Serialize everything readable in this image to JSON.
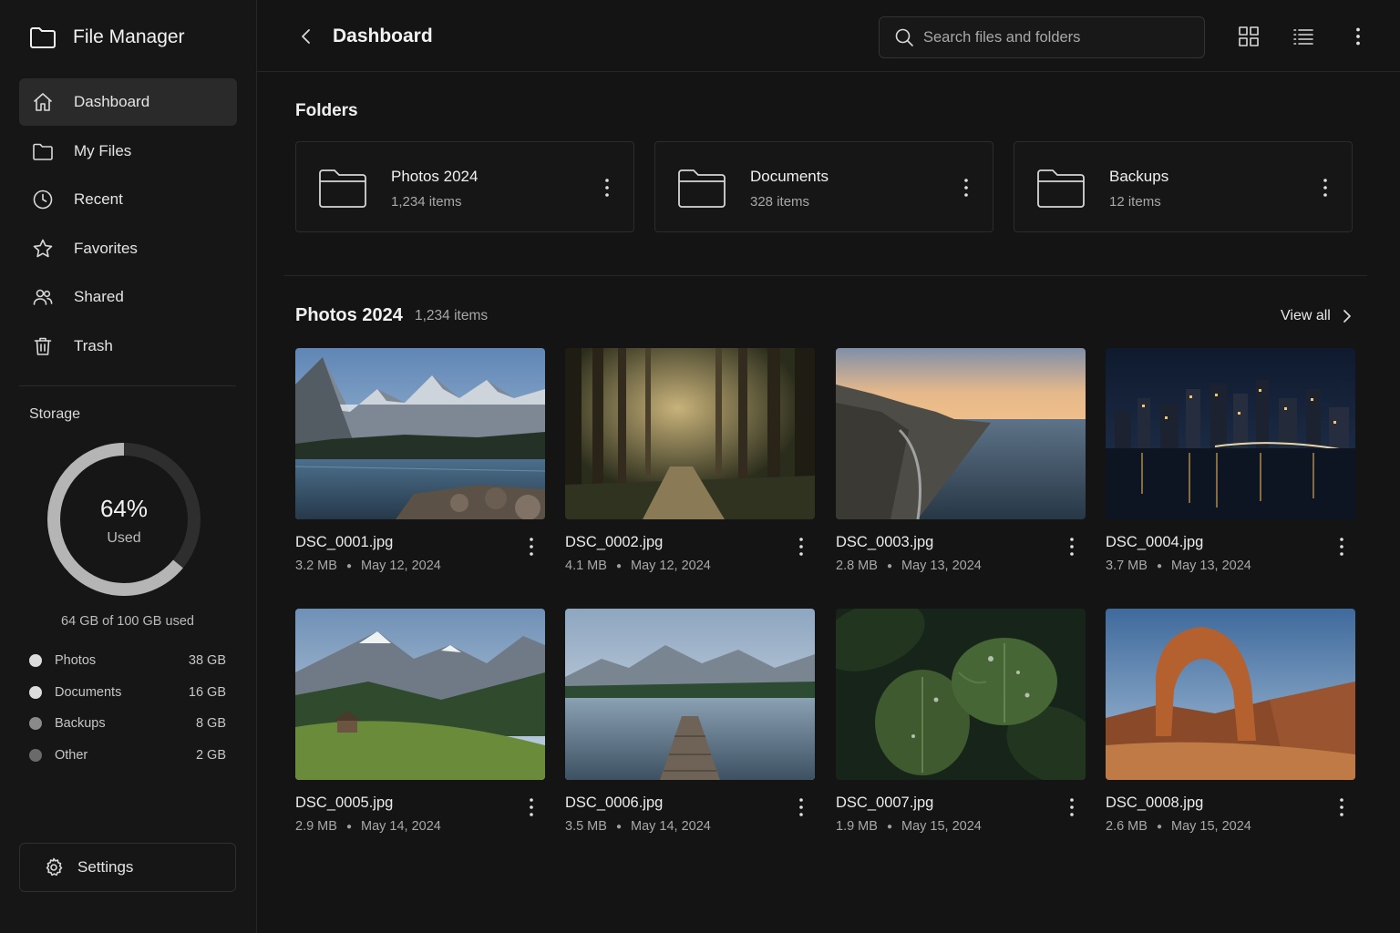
{
  "app": {
    "title": "File Manager",
    "icon": "folder-icon"
  },
  "nav": {
    "items": [
      {
        "label": "Dashboard",
        "icon": "home-icon",
        "active": true
      },
      {
        "label": "My Files",
        "icon": "folder-icon",
        "active": false
      },
      {
        "label": "Recent",
        "icon": "clock-icon",
        "active": false
      },
      {
        "label": "Favorites",
        "icon": "star-icon",
        "active": false
      },
      {
        "label": "Shared",
        "icon": "users-icon",
        "active": false
      },
      {
        "label": "Trash",
        "icon": "trash-icon",
        "active": false
      }
    ]
  },
  "storage": {
    "title": "Storage",
    "percent_label": "64%",
    "used_fraction": 0.64,
    "used_label": "Used",
    "summary": "64 GB of 100 GB used",
    "colors": {
      "used": "#b5b5b5",
      "track": "#2e2e2e"
    },
    "breakdown": [
      {
        "name": "Photos",
        "size": "38 GB",
        "color": "#dcdcdc"
      },
      {
        "name": "Documents",
        "size": "16 GB",
        "color": "#dcdcdc"
      },
      {
        "name": "Backups",
        "size": "8 GB",
        "color": "#8a8a8a"
      },
      {
        "name": "Other",
        "size": "2 GB",
        "color": "#6a6a6a"
      }
    ]
  },
  "settings": {
    "label": "Settings",
    "icon": "gear-icon"
  },
  "header": {
    "back_icon": "chevron-left-icon",
    "title": "Dashboard",
    "search_placeholder": "Search files and folders",
    "grid_view_icon": "grid-view-icon",
    "list_view_icon": "list-view-icon",
    "more_icon": "more-vertical-icon"
  },
  "folders": {
    "title": "Folders",
    "items": [
      {
        "name": "Photos 2024",
        "count": "1,234 items"
      },
      {
        "name": "Documents",
        "count": "328 items"
      },
      {
        "name": "Backups",
        "count": "12 items"
      }
    ]
  },
  "photos": {
    "title": "Photos 2024",
    "count": "1,234 items",
    "view_all": "View all",
    "items": [
      {
        "name": "DSC_0001.jpg",
        "size": "3.2 MB",
        "date": "May 12, 2024",
        "scene": "mountain-lake"
      },
      {
        "name": "DSC_0002.jpg",
        "size": "4.1 MB",
        "date": "May 12, 2024",
        "scene": "forest-path"
      },
      {
        "name": "DSC_0003.jpg",
        "size": "2.8 MB",
        "date": "May 13, 2024",
        "scene": "sea-cliffs"
      },
      {
        "name": "DSC_0004.jpg",
        "size": "3.7 MB",
        "date": "May 13, 2024",
        "scene": "city-night"
      },
      {
        "name": "DSC_0005.jpg",
        "size": "2.9 MB",
        "date": "May 14, 2024",
        "scene": "alpine-valley"
      },
      {
        "name": "DSC_0006.jpg",
        "size": "3.5 MB",
        "date": "May 14, 2024",
        "scene": "lake-pier"
      },
      {
        "name": "DSC_0007.jpg",
        "size": "1.9 MB",
        "date": "May 15, 2024",
        "scene": "green-leaves"
      },
      {
        "name": "DSC_0008.jpg",
        "size": "2.6 MB",
        "date": "May 15, 2024",
        "scene": "desert-arch"
      }
    ]
  }
}
